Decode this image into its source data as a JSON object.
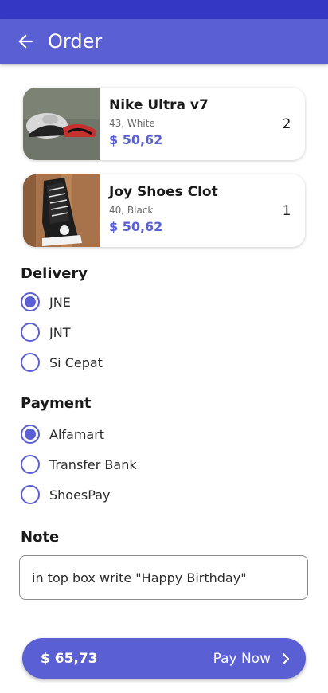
{
  "app_bar": {
    "title": "Order",
    "back_icon": "arrow-back-icon"
  },
  "colors": {
    "primary": "#5a5fd3",
    "status_bar": "#3338c4"
  },
  "cart": [
    {
      "name": "Nike Ultra v7",
      "variant": "43, White",
      "price": "$ 50,62",
      "qty": "2",
      "image": "sneaker-photo"
    },
    {
      "name": "Joy Shoes Clot",
      "variant": "40, Black",
      "price": "$ 50,62",
      "qty": "1",
      "image": "sneaker-photo"
    }
  ],
  "delivery": {
    "title": "Delivery",
    "options": [
      {
        "label": "JNE",
        "selected": true
      },
      {
        "label": "JNT",
        "selected": false
      },
      {
        "label": "Si Cepat",
        "selected": false
      }
    ]
  },
  "payment": {
    "title": "Payment",
    "options": [
      {
        "label": "Alfamart",
        "selected": true
      },
      {
        "label": "Transfer Bank",
        "selected": false
      },
      {
        "label": "ShoesPay",
        "selected": false
      }
    ]
  },
  "note": {
    "title": "Note",
    "value": "in top box write \"Happy Birthday\""
  },
  "checkout": {
    "total": "$ 65,73",
    "label": "Pay Now",
    "icon": "chevron-right-icon"
  }
}
